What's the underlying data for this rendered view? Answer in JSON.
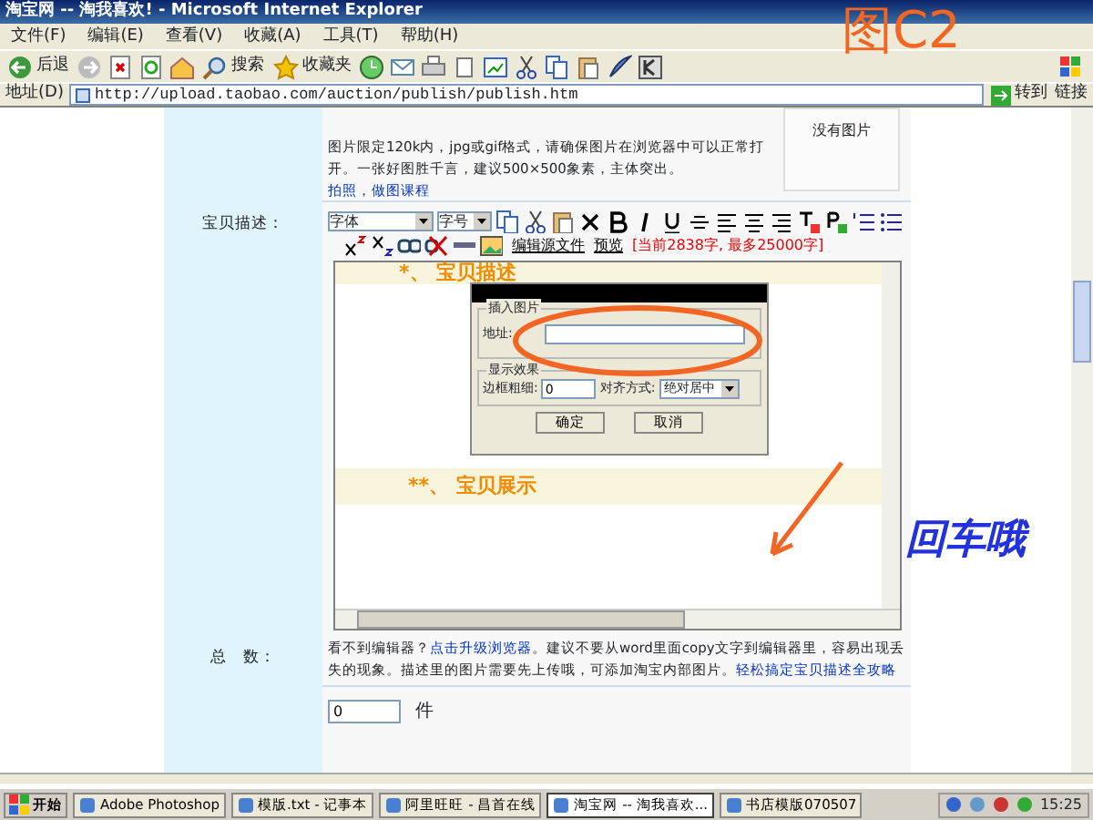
{
  "window": {
    "title": "淘宝网 -- 淘我喜欢! - Microsoft Internet Explorer"
  },
  "menu": [
    "文件(F)",
    "编辑(E)",
    "查看(V)",
    "收藏(A)",
    "工具(T)",
    "帮助(H)"
  ],
  "toolbar": [
    {
      "kind": "back",
      "label": "后退"
    },
    {
      "kind": "forward"
    },
    {
      "kind": "stop"
    },
    {
      "kind": "refresh"
    },
    {
      "kind": "home"
    },
    {
      "kind": "search",
      "label": "搜索"
    },
    {
      "kind": "favorites",
      "label": "收藏夹"
    },
    {
      "kind": "history"
    },
    {
      "kind": "mail"
    },
    {
      "kind": "print"
    },
    {
      "kind": "edit"
    },
    {
      "kind": "discuss"
    },
    {
      "kind": "cut"
    },
    {
      "kind": "copy"
    },
    {
      "kind": "paste"
    },
    {
      "kind": "messenger"
    },
    {
      "kind": "k"
    }
  ],
  "address": {
    "label": "地址(D)",
    "value": "http://upload.taobao.com/auction/publish/publish.htm",
    "go": "转到",
    "links": "链接"
  },
  "image_row": {
    "hint": "图片限定120k内，jpg或gif格式，请确保图片在浏览器中可以正常打开。一张好图胜千言，建议500×500象素，主体突出。",
    "hint_link": "拍照，做图课程",
    "no_image": "没有图片"
  },
  "description": {
    "label": "宝贝描述：",
    "font_select": "字体",
    "size_select": "字号",
    "tools_1": [
      {
        "kind": "copy"
      },
      {
        "kind": "cut"
      },
      {
        "kind": "paste"
      },
      {
        "kind": "delete"
      },
      {
        "kind": "bold"
      },
      {
        "kind": "italic"
      },
      {
        "kind": "underline"
      },
      {
        "kind": "strike"
      },
      {
        "kind": "align-left"
      },
      {
        "kind": "align-center"
      },
      {
        "kind": "align-right"
      },
      {
        "kind": "text-color"
      },
      {
        "kind": "back-color"
      },
      {
        "kind": "ordered-list"
      },
      {
        "kind": "bullet-list"
      }
    ],
    "tools_2": [
      {
        "kind": "superscript"
      },
      {
        "kind": "subscript"
      },
      {
        "kind": "link"
      },
      {
        "kind": "unlink"
      },
      {
        "kind": "rule"
      },
      {
        "kind": "image"
      }
    ],
    "source_link": "编辑源文件",
    "preview_link": "预览",
    "counter": "[当前2838字, 最多25000字]",
    "headings": [
      "*、 宝贝描述",
      "**、 宝贝展示"
    ]
  },
  "dialog": {
    "group_1": "插入图片",
    "address_label": "地址:",
    "group_2": "显示效果",
    "border_label": "边框粗细:",
    "border_value": "0",
    "align_label": "对齐方式:",
    "align_value": "绝对居中",
    "ok": "确定",
    "cancel": "取消"
  },
  "note": {
    "text_1": "看不到编辑器？",
    "link_1": "点击升级浏览器",
    "text_2": "。建议不要从word里面copy文字到编辑器里，容易出现丢失的现象。描述里的图片需要先上传哦，可添加淘宝内部图片。",
    "link_2": "轻松搞定宝贝描述全攻略"
  },
  "quantity": {
    "label": "总　数：",
    "value": "0",
    "unit": "件"
  },
  "annotations": [
    {
      "kind": "caption",
      "text": "图C2"
    },
    {
      "kind": "ellipse"
    },
    {
      "kind": "arrow"
    },
    {
      "kind": "note",
      "text": "回车哦"
    }
  ],
  "taskbar": {
    "start": "开始",
    "tasks": [
      {
        "label": "Adobe Photoshop",
        "selected": false
      },
      {
        "label": "模版.txt - 记事本",
        "selected": false
      },
      {
        "label": "阿里旺旺 - 昌首在线",
        "selected": false
      },
      {
        "label": "淘宝网 -- 淘我喜欢...",
        "selected": true
      },
      {
        "label": "书店模版070507",
        "selected": false
      }
    ],
    "clock": "15:25"
  }
}
